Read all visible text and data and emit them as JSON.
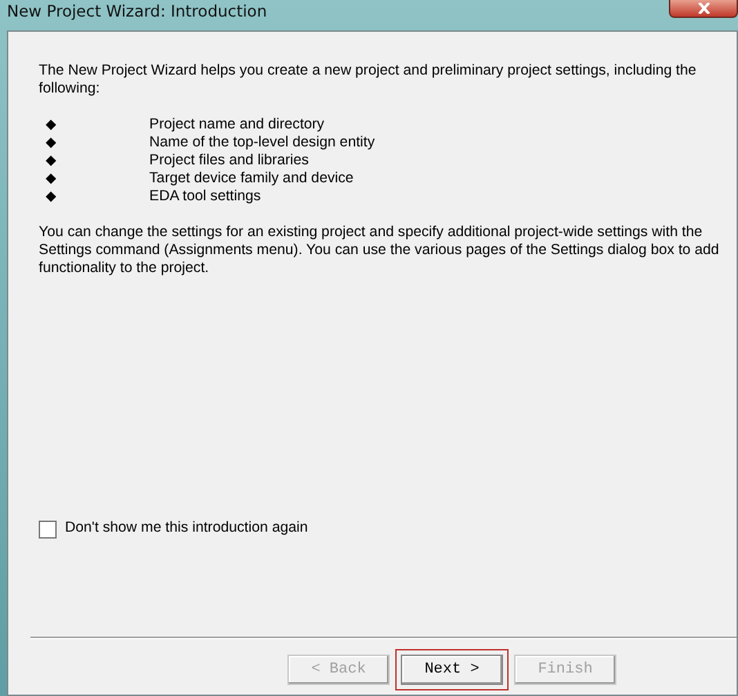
{
  "window": {
    "title": "New Project Wizard: Introduction"
  },
  "intro": "The New Project Wizard helps you create a new project and preliminary project settings, including the following:",
  "items": [
    "Project name and directory",
    "Name of the top-level design entity",
    "Project files and libraries",
    "Target device family and device",
    "EDA tool settings"
  ],
  "bullet": "◆",
  "note": "You can change the settings for an existing project and specify additional project-wide settings with the Settings command (Assignments menu). You can use the various pages of the Settings dialog box to add functionality to the project.",
  "checkbox": {
    "label": "Don't show me this introduction again",
    "checked": false
  },
  "buttons": [
    {
      "label": "< Back",
      "disabled": true,
      "highlighted": false
    },
    {
      "label": "Next >",
      "disabled": false,
      "highlighted": true
    },
    {
      "label": "Finish",
      "disabled": true,
      "highlighted": false
    }
  ]
}
